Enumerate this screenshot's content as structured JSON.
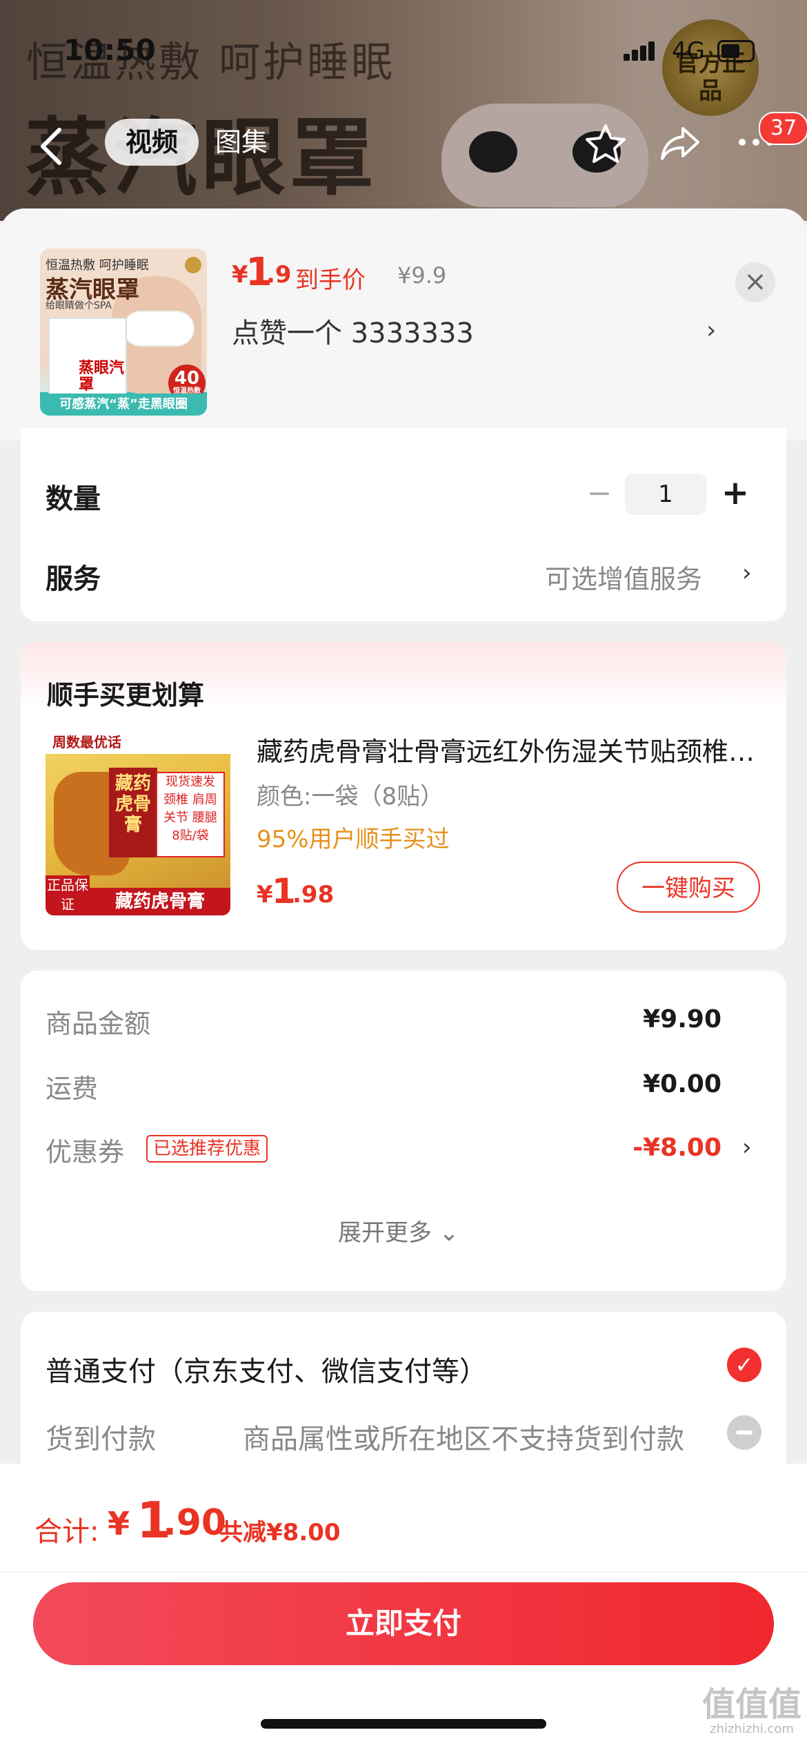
{
  "status_bar": {
    "time": "10:50",
    "network": "4G"
  },
  "background": {
    "slogan": "恒温热敷 呵护睡眠",
    "headline": "蒸汽眼罩",
    "seal_text": "官方正品"
  },
  "header": {
    "tab_video": "视频",
    "tab_images": "图集",
    "more_badge": "37"
  },
  "product": {
    "thumb": {
      "line1": "恒温热敷 呵护睡眠",
      "line2": "蒸汽眼罩",
      "line3": "给眼睛做个SPA",
      "box_text": "蒸眼汽罩",
      "pill_number": "40",
      "pill_sub": "恒温热敷",
      "bottom": "可感蒸汽“蒸”走黑眼圈"
    },
    "price_yen": "¥",
    "price_int": "1",
    "price_dec": ".9",
    "price_label": "到手价",
    "original_price": "¥9.9",
    "spec": "点赞一个  3333333"
  },
  "quantity": {
    "label": "数量",
    "value": "1"
  },
  "service": {
    "label": "服务",
    "value": "可选增值服务"
  },
  "bundle": {
    "title": "顺手买更划算",
    "img": {
      "strip": "周数最优话",
      "box": "藏药虎骨膏",
      "tag_lines": [
        "现货速发",
        "颈椎 肩周",
        "关节 腰腿",
        "8贴/袋"
      ],
      "guarantee": "正品保证",
      "name": "藏药虎骨膏"
    },
    "name": "藏药虎骨膏壮骨膏远红外伤湿关节贴颈椎肩周",
    "spec": "颜色:一袋（8贴）",
    "stat": "95%用户顺手买过",
    "price_yen": "¥",
    "price_int": "1",
    "price_dec": ".98",
    "buy_label": "一键购买"
  },
  "amounts": {
    "goods_label": "商品金额",
    "goods_value": "¥9.90",
    "shipping_label": "运费",
    "shipping_value": "¥0.00",
    "coupon_label": "优惠券",
    "coupon_tag": "已选推荐优惠",
    "coupon_value": "-¥8.00",
    "expand": "展开更多 ⌄"
  },
  "payment": {
    "normal": "普通支付（京东支付、微信支付等）",
    "cod": "货到付款",
    "cod_note": "商品属性或所在地区不支持货到付款"
  },
  "bottom": {
    "total_label": "合计:",
    "total_yen": "¥",
    "total_int": "1",
    "total_dec": ".90",
    "saved": "共减¥8.00",
    "pay_button": "立即支付"
  },
  "watermark": {
    "logo": "值值值",
    "site": "zhizhizhi.com"
  },
  "colors": {
    "accent": "#e93323",
    "pay_button": "#f0272e",
    "orange": "#e6911b"
  }
}
